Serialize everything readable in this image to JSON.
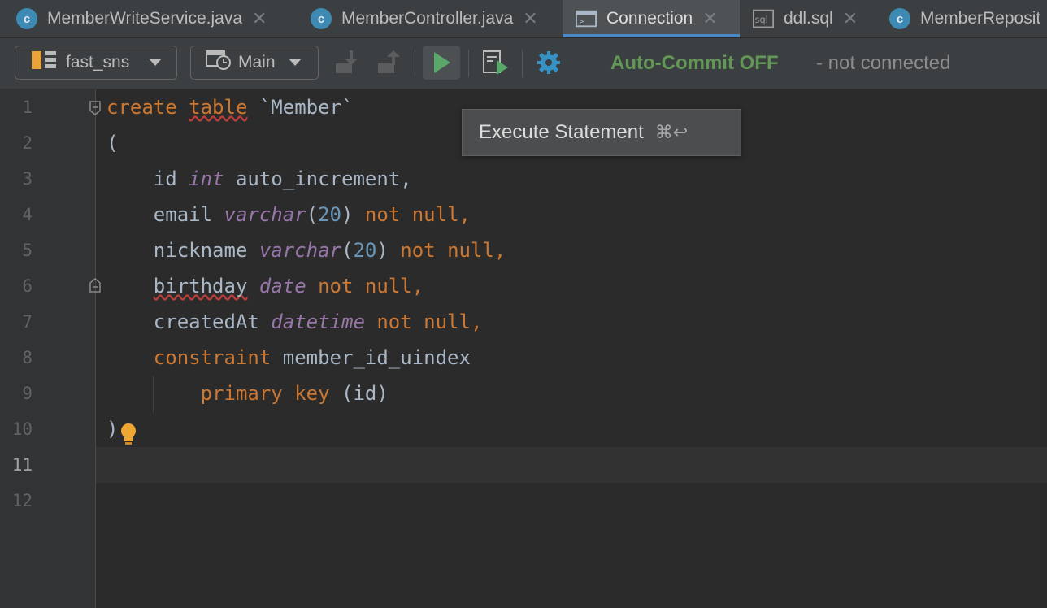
{
  "tabs": [
    {
      "label": "MemberWriteService.java",
      "icon": "class-icon",
      "active": false
    },
    {
      "label": "MemberController.java",
      "icon": "class-icon",
      "active": false
    },
    {
      "label": "Connection",
      "icon": "console-icon",
      "active": true
    },
    {
      "label": "ddl.sql",
      "icon": "sql-file-icon",
      "active": false
    },
    {
      "label": "MemberReposit",
      "icon": "class-icon",
      "active": false
    }
  ],
  "toolbar": {
    "datasource": "fast_sns",
    "session": "Main",
    "auto_commit": "Auto-Commit OFF",
    "connection_status": "- not connected"
  },
  "tooltip": {
    "label": "Execute Statement",
    "shortcut": "⌘↩"
  },
  "editor": {
    "line_numbers": [
      "1",
      "2",
      "3",
      "4",
      "5",
      "6",
      "7",
      "8",
      "9",
      "10",
      "11",
      "12"
    ],
    "current_line": "11",
    "lines": {
      "l1": {
        "kw1": "create",
        "kw2": "table",
        "name": "`Member`"
      },
      "l2": {
        "text": "("
      },
      "l3": {
        "col": "id",
        "type": "int",
        "rest": "auto_increment,"
      },
      "l4": {
        "col": "email",
        "type": "varchar",
        "open": "(",
        "num": "20",
        "close": ")",
        "nn": "not null",
        "comma": ","
      },
      "l5": {
        "col": "nickname",
        "type": "varchar",
        "open": "(",
        "num": "20",
        "close": ")",
        "nn": "not null",
        "comma": ","
      },
      "l6": {
        "col": "birthday",
        "type": "date",
        "nn": "not null",
        "comma": ","
      },
      "l7": {
        "col": "createdAt",
        "type": "datetime",
        "nn": "not null",
        "comma": ","
      },
      "l8": {
        "kw": "constraint",
        "name": "member_id_uindex"
      },
      "l9": {
        "kw": "primary key",
        "rest": "(id)"
      },
      "l10": {
        "text": ")"
      }
    }
  },
  "colors": {
    "keyword": "#cc7832",
    "type": "#9876aa",
    "number": "#6897bb",
    "identifier": "#a9b7c6",
    "auto_commit": "#629755",
    "run": "#59a869"
  }
}
